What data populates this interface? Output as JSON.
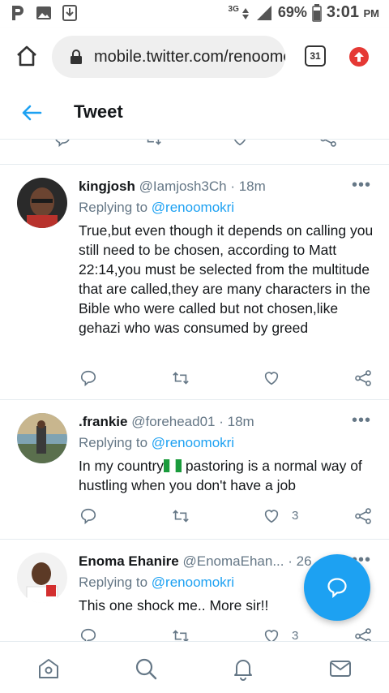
{
  "status_bar": {
    "network": "3G",
    "battery": "69%",
    "time": "3:01",
    "ampm": "PM",
    "left_icons": [
      "p-icon",
      "image-icon",
      "download-icon"
    ]
  },
  "browser": {
    "url": "mobile.twitter.com/renoomokri",
    "tab_count": "31"
  },
  "header": {
    "title": "Tweet"
  },
  "tweets": [
    {
      "name": "kingjosh",
      "handle": "@Iamjosh3Ch",
      "time": "· 18m",
      "replying_label": "Replying to",
      "replying_to": "@renoomokri",
      "text": "True,but even though it depends on calling you still need to be chosen, according to Matt 22:14,you must be selected from the multitude that are called,they are many characters in the Bible who were called but not chosen,like gehazi  who was consumed by greed",
      "likes": ""
    },
    {
      "name": ".frankie",
      "handle": "@forehead01",
      "time": "· 18m",
      "replying_label": "Replying to",
      "replying_to": "@renoomokri",
      "text_before": "In my country",
      "text_after": " pastoring is a normal way of hustling when you don't have a job",
      "likes": "3"
    },
    {
      "name": "Enoma Ehanire",
      "handle": "@EnomaEhan...",
      "time": "· 26",
      "replying_label": "Replying to",
      "replying_to": "@renoomokri",
      "text": "This one shock me.. More sir!!",
      "likes": "3"
    }
  ],
  "colors": {
    "accent": "#1da1f2",
    "secondary_text": "#657786",
    "primary_text": "#14171a",
    "divider": "#e6ecf0"
  }
}
